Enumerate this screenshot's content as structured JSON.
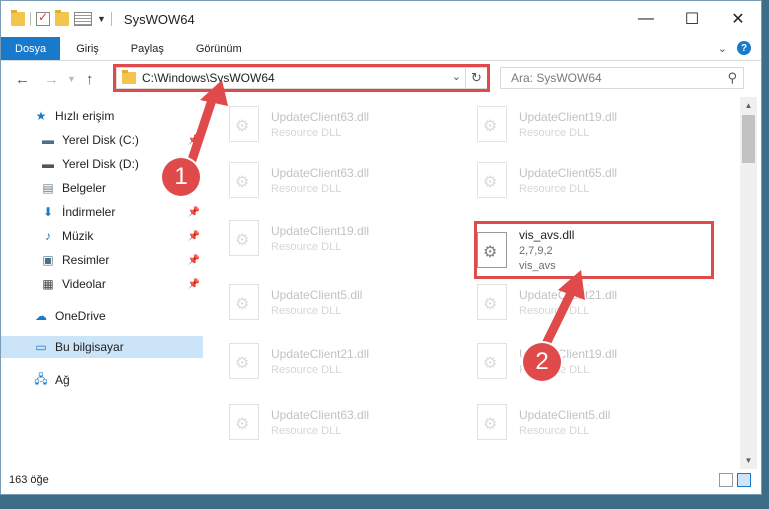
{
  "window": {
    "title": "SysWOW64"
  },
  "ribbon": {
    "tabs": [
      "Dosya",
      "Giriş",
      "Paylaş",
      "Görünüm"
    ]
  },
  "nav": {
    "address": "C:\\Windows\\SysWOW64",
    "search_placeholder": "Ara: SysWOW64"
  },
  "sidebar": {
    "quick_access": "Hızlı erişim",
    "items": [
      {
        "label": "Yerel Disk (C:)"
      },
      {
        "label": "Yerel Disk (D:)"
      },
      {
        "label": "Belgeler"
      },
      {
        "label": "İndirmeler"
      },
      {
        "label": "Müzik"
      },
      {
        "label": "Resimler"
      },
      {
        "label": "Videolar"
      }
    ],
    "onedrive": "OneDrive",
    "this_pc": "Bu bilgisayar",
    "network": "Ağ"
  },
  "files": {
    "left": [
      {
        "name": "UpdateClient63.dll",
        "type": "Resource DLL"
      },
      {
        "name": "UpdateClient63.dll",
        "type": "Resource DLL"
      },
      {
        "name": "UpdateClient19.dll",
        "type": "Resource DLL"
      },
      {
        "name": "UpdateClient5.dll",
        "type": "Resource DLL"
      },
      {
        "name": "UpdateClient21.dll",
        "type": "Resource DLL"
      },
      {
        "name": "UpdateClient63.dll",
        "type": "Resource DLL"
      }
    ],
    "right": [
      {
        "name": "UpdateClient19.dll",
        "type": "Resource DLL"
      },
      {
        "name": "UpdateClient65.dll",
        "type": "Resource DLL"
      },
      {
        "name": "UpdateClient21.dll",
        "type": "Resource DLL"
      },
      {
        "name": "UpdateClient19.dll",
        "type": "Resource DLL"
      },
      {
        "name": "UpdateClient5.dll",
        "type": "Resource DLL"
      }
    ],
    "highlighted": {
      "name": "vis_avs.dll",
      "version": "2,7,9,2",
      "description": "vis_avs"
    }
  },
  "status": {
    "count": "163 öğe"
  },
  "callouts": [
    "1",
    "2"
  ],
  "colors": {
    "accent": "#1979ca",
    "annotation": "#e04a4a"
  }
}
